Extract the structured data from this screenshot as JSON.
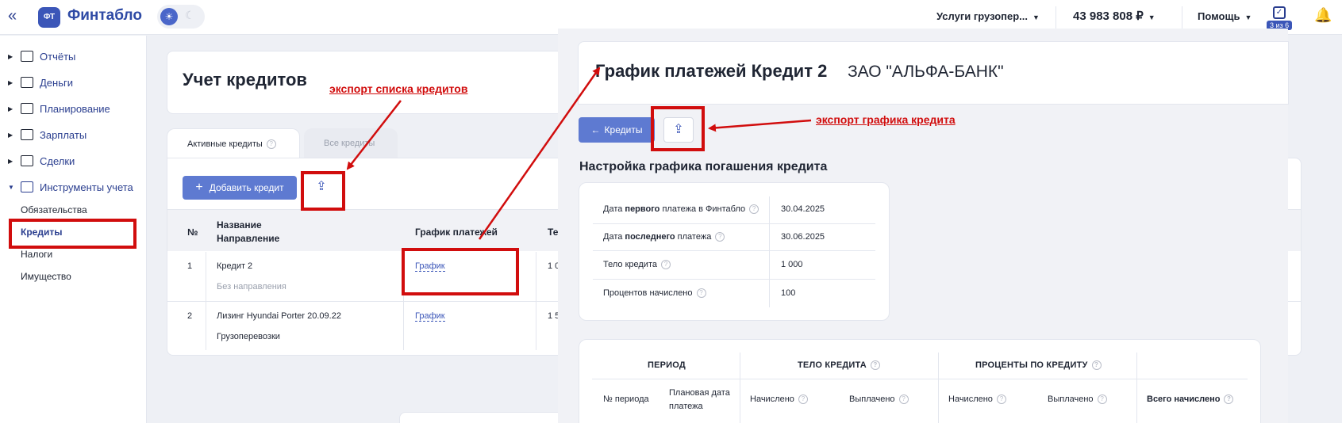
{
  "header": {
    "logo_text": "ФТ",
    "brand": "Финтабло",
    "company": "Услуги грузопер...",
    "balance": "43 983 808 ₽",
    "help": "Помощь",
    "tasks_badge": "3 из 6"
  },
  "sidebar": {
    "items": [
      {
        "label": "Отчёты"
      },
      {
        "label": "Деньги"
      },
      {
        "label": "Планирование"
      },
      {
        "label": "Зарплаты"
      },
      {
        "label": "Сделки"
      },
      {
        "label": "Инструменты учета"
      }
    ],
    "subitems": [
      {
        "label": "Обязательства"
      },
      {
        "label": "Кредиты"
      },
      {
        "label": "Налоги"
      },
      {
        "label": "Имущество"
      }
    ]
  },
  "main": {
    "title": "Учет кредитов",
    "tabs": [
      {
        "label": "Активные кредиты"
      },
      {
        "label": "Все кредиты"
      }
    ],
    "add_button": "Добавить кредит",
    "table": {
      "col_num": "№",
      "col_name_1": "Название",
      "col_name_2": "Направление",
      "col_schedule": "График платежей",
      "col_body": "Те",
      "rows": [
        {
          "num": "1",
          "name": "Кредит 2",
          "direction": "Без направления",
          "schedule": "График",
          "body": "1 0"
        },
        {
          "num": "2",
          "name": "Лизинг Hyundai Porter 20.09.22",
          "direction": "Грузоперевозки",
          "schedule": "График",
          "body": "1 5"
        }
      ]
    }
  },
  "panel": {
    "title": "График платежей Кредит 2",
    "bank": "ЗАО \"АЛЬФА-БАНК\"",
    "back_button": "Кредиты",
    "section_title": "Настройка графика погашения кредита",
    "settings": {
      "first_date_pre": "Дата ",
      "first_date_bold": "первого",
      "first_date_post": " платежа в Финтабло",
      "first_date_value": "30.04.2025",
      "last_date_pre": "Дата ",
      "last_date_bold": "последнего",
      "last_date_post": " платежа",
      "last_date_value": "30.06.2025",
      "body_label": "Тело кредита",
      "body_value": "1 000",
      "interest_label": "Процентов начислено",
      "interest_value": "100"
    },
    "schedule": {
      "group_period": "ПЕРИОД",
      "group_body": "ТЕЛО КРЕДИТА",
      "group_interest": "ПРОЦЕНТЫ ПО КРЕДИТУ",
      "col_period_num": "№ периода",
      "col_planned_date_1": "Плановая дата",
      "col_planned_date_2": "платежа",
      "col_body_accrued": "Начислено",
      "col_body_paid": "Выплачено",
      "col_int_accrued": "Начислено",
      "col_int_paid": "Выплачено",
      "col_total": "Всего начислено"
    }
  },
  "annotations": {
    "export_list": "экспорт списка кредитов",
    "export_schedule": "экспорт графика кредита"
  },
  "colors": {
    "accent": "#3b56b8",
    "button": "#5e7ad1",
    "annotation": "#d10d0d"
  }
}
